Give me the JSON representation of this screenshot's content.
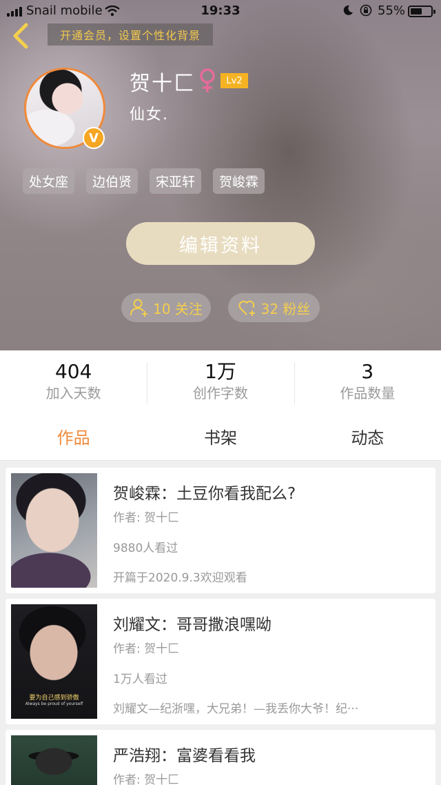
{
  "status_bar": {
    "carrier": "Snail mobile",
    "time": "19:33",
    "battery_percent": "55%",
    "battery_level": 0.55
  },
  "vip_banner": "开通会员，设置个性化背景",
  "profile": {
    "username": "贺十匚",
    "level": "Lv2",
    "bio": "仙女.",
    "verified_badge": "V",
    "tags": [
      "处女座",
      "边伯贤",
      "宋亚轩",
      "贺峻霖"
    ]
  },
  "edit_button": "编辑资料",
  "follow_count": "10 关注",
  "fans_count": "32 粉丝",
  "stats": [
    {
      "value": "404",
      "label": "加入天数"
    },
    {
      "value": "1万",
      "label": "创作字数"
    },
    {
      "value": "3",
      "label": "作品数量"
    }
  ],
  "tabs": [
    {
      "label": "作品",
      "active": true
    },
    {
      "label": "书架",
      "active": false
    },
    {
      "label": "动态",
      "active": false
    }
  ],
  "works": [
    {
      "title": "贺峻霖：土豆你看我配么?",
      "author": "作者: 贺十匚",
      "views": "9880人看过",
      "description": "开篇于2020.9.3欢迎观看"
    },
    {
      "title": "刘耀文：哥哥撒浪嘿呦",
      "author": "作者: 贺十匚",
      "views": "1万人看过",
      "description": "刘耀文—纪浙嘿，大兄弟！—我丢你大爷！纪···",
      "cover_caption": "要为自己感到骄傲",
      "cover_caption_en": "Always be proud of yourself"
    },
    {
      "title": "严浩翔：富婆看看我",
      "author": "作者: 贺十匚"
    }
  ],
  "colors": {
    "accent": "#f0893a",
    "gold": "#f4cf4c",
    "level_badge": "#f5b323"
  }
}
